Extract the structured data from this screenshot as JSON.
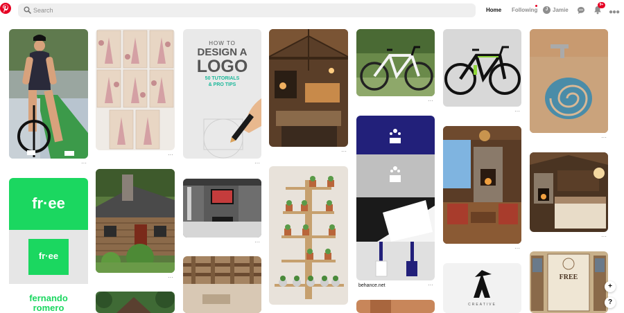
{
  "header": {
    "search_placeholder": "Search",
    "nav_home": "Home",
    "nav_following": "Following",
    "user_initial": "J",
    "user_name": "Jamie",
    "notification_count": "9+",
    "icons": [
      "pinterest-logo-icon",
      "search-icon",
      "chat-icon",
      "bell-icon",
      "more-icon"
    ]
  },
  "pins": {
    "logo_title": [
      "HOW TO",
      "DESIGN A",
      "LOGO"
    ],
    "logo_subtitle": [
      "50 TUTORIALS",
      "& PRO TIPS"
    ],
    "freebie_logo": "fr·ee",
    "freebie_badge": "fr·ee",
    "freebie_name": [
      "fernando",
      "romero"
    ],
    "behance_caption": "behance.net",
    "more_label": "···",
    "eagle_caption": "CREATIVE",
    "free_badge": "FREE"
  },
  "floating": {
    "plus_label": "+",
    "help_label": "?"
  },
  "colors": {
    "brand": "#e60023",
    "freebie_green": "#1bd760",
    "nav_dark": "#111111"
  }
}
